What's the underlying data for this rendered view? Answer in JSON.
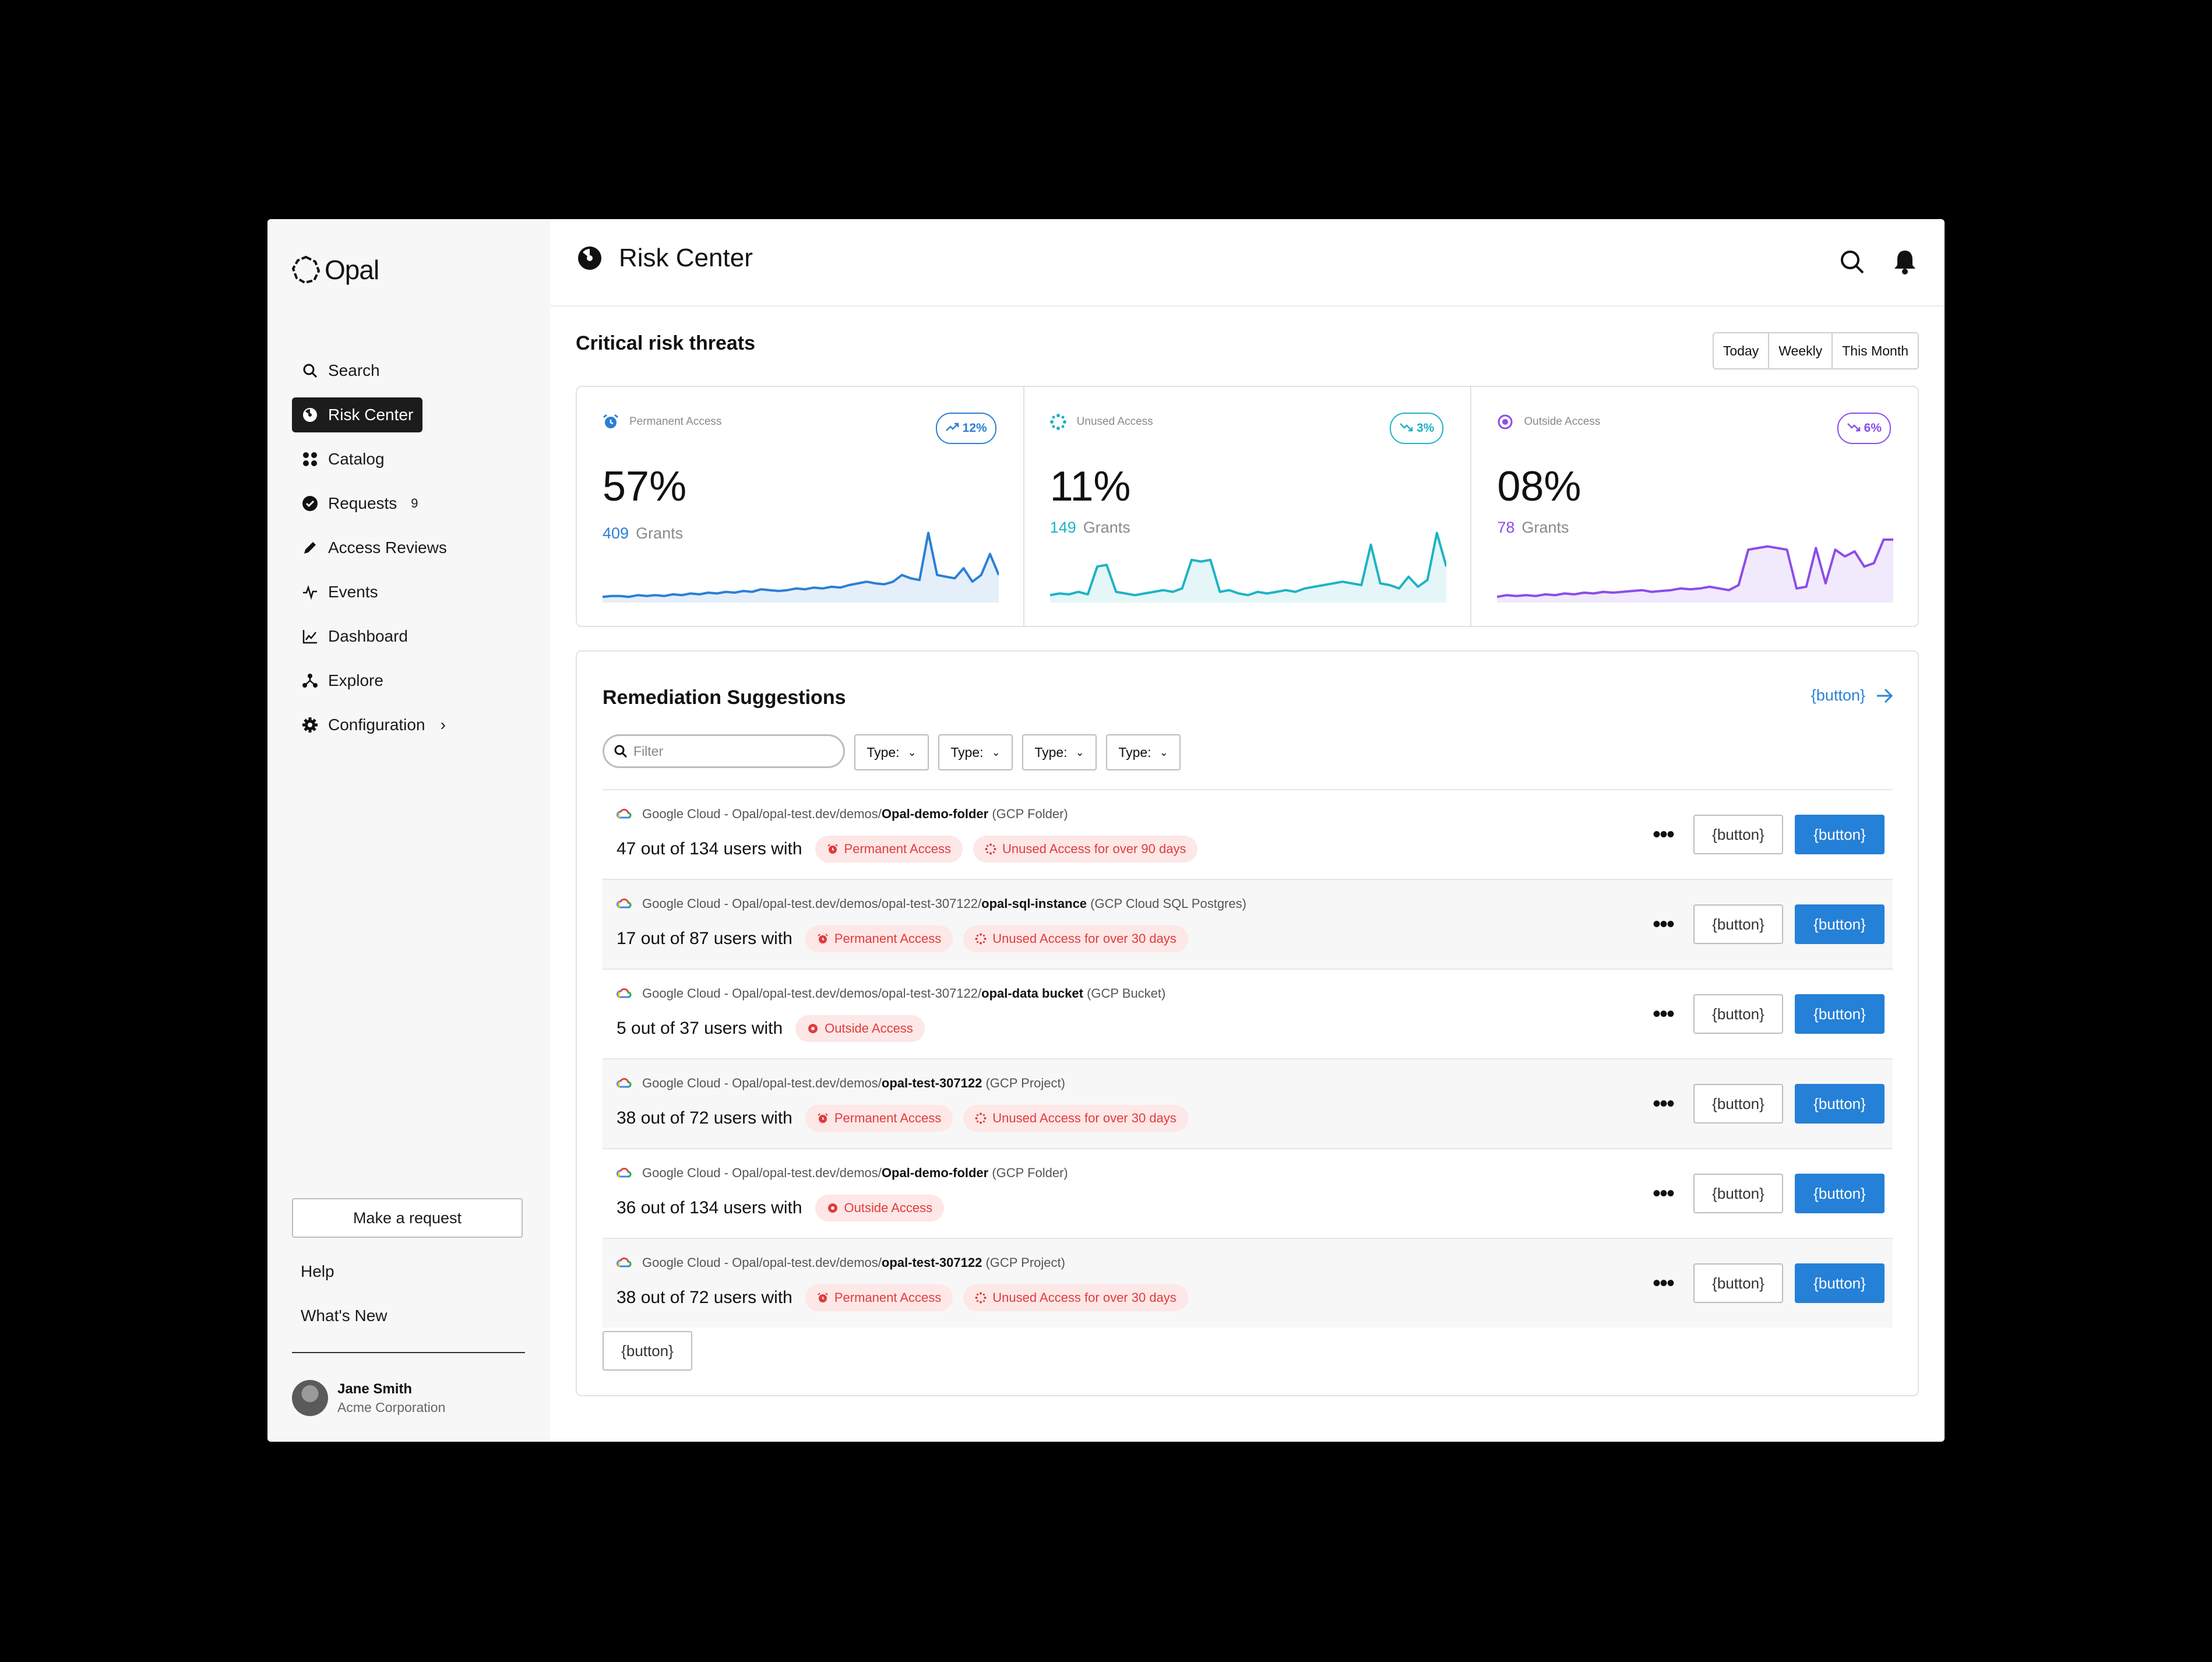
{
  "app": {
    "name": "Opal"
  },
  "sidebar": {
    "items": [
      {
        "label": "Search",
        "icon": "search-icon"
      },
      {
        "label": "Risk Center",
        "icon": "risk-icon",
        "active": true
      },
      {
        "label": "Catalog",
        "icon": "grid-icon"
      },
      {
        "label": "Requests",
        "icon": "check-circle-icon",
        "count": "9"
      },
      {
        "label": "Access Reviews",
        "icon": "pencil-icon"
      },
      {
        "label": "Events",
        "icon": "activity-icon"
      },
      {
        "label": "Dashboard",
        "icon": "chart-icon"
      },
      {
        "label": "Explore",
        "icon": "nodes-icon"
      },
      {
        "label": "Configuration",
        "icon": "gear-icon",
        "has_submenu": true
      }
    ],
    "make_request": "Make a request",
    "help": "Help",
    "whats_new": "What's New",
    "user": {
      "name": "Jane Smith",
      "org": "Acme Corporation"
    }
  },
  "header": {
    "title": "Risk Center"
  },
  "risk": {
    "title": "Critical risk threats",
    "periods": [
      "Today",
      "Weekly",
      "This Month"
    ],
    "metrics": [
      {
        "label": "Permanent Access",
        "trend": "12%",
        "trend_dir": "up",
        "value": "57%",
        "grants_count": "409",
        "grants_label": "Grants",
        "color": "#2b7fd4",
        "series": [
          4,
          5,
          5,
          4,
          6,
          5,
          6,
          5,
          7,
          6,
          8,
          7,
          9,
          8,
          10,
          9,
          11,
          10,
          13,
          12,
          11,
          12,
          14,
          13,
          15,
          14,
          16,
          15,
          18,
          20,
          22,
          20,
          19,
          22,
          30,
          26,
          24,
          80,
          30,
          28,
          26,
          38,
          22,
          30,
          55,
          30
        ]
      },
      {
        "label": "Unused Access",
        "trend": "3%",
        "trend_dir": "down",
        "value": "11%",
        "grants_count": "149",
        "grants_label": "Grants",
        "color": "#1eb3c4",
        "series": [
          6,
          8,
          7,
          10,
          7,
          40,
          42,
          10,
          8,
          6,
          8,
          10,
          12,
          10,
          14,
          48,
          46,
          48,
          10,
          12,
          8,
          6,
          10,
          8,
          10,
          12,
          10,
          14,
          16,
          18,
          20,
          22,
          20,
          18,
          66,
          20,
          18,
          14,
          28,
          16,
          24,
          80,
          40
        ]
      },
      {
        "label": "Outside Access",
        "trend": "6%",
        "trend_dir": "down",
        "value": "08%",
        "grants_count": "78",
        "grants_label": "Grants",
        "color": "#8b4dea",
        "series": [
          4,
          6,
          5,
          6,
          5,
          7,
          6,
          8,
          7,
          9,
          8,
          10,
          9,
          10,
          11,
          12,
          10,
          11,
          12,
          14,
          13,
          14,
          16,
          14,
          12,
          18,
          60,
          62,
          64,
          62,
          60,
          14,
          16,
          62,
          20,
          60,
          52,
          58,
          40,
          44,
          72,
          72
        ]
      }
    ]
  },
  "remediation": {
    "title": "Remediation Suggestions",
    "link": "{button}",
    "filter_placeholder": "Filter",
    "type_filters": [
      "Type:",
      "Type:",
      "Type:",
      "Type:"
    ],
    "rows": [
      {
        "path_prefix": "Google Cloud - Opal/opal-test.dev/demos/",
        "resource": "Opal-demo-folder",
        "kind": "(GCP Folder)",
        "count": "47 out of 134 users with",
        "tags": [
          {
            "label": "Permanent Access",
            "icon": "alarm-icon"
          },
          {
            "label": "Unused Access for over 90 days",
            "icon": "dotted-circle-icon"
          }
        ],
        "secondary": "{button}",
        "primary": "{button}"
      },
      {
        "path_prefix": "Google Cloud - Opal/opal-test.dev/demos/opal-test-307122/",
        "resource": "opal-sql-instance",
        "kind": "(GCP Cloud SQL Postgres)",
        "count": "17 out of 87 users with",
        "tags": [
          {
            "label": "Permanent Access",
            "icon": "alarm-icon"
          },
          {
            "label": "Unused Access for over 30 days",
            "icon": "dotted-circle-icon"
          }
        ],
        "secondary": "{button}",
        "primary": "{button}"
      },
      {
        "path_prefix": "Google Cloud - Opal/opal-test.dev/demos/opal-test-307122/",
        "resource": "opal-data bucket",
        "kind": "(GCP Bucket)",
        "count": "5 out of 37 users with",
        "tags": [
          {
            "label": "Outside Access",
            "icon": "target-icon"
          }
        ],
        "secondary": "{button}",
        "primary": "{button}"
      },
      {
        "path_prefix": "Google Cloud - Opal/opal-test.dev/demos/",
        "resource": "opal-test-307122",
        "kind": "(GCP Project)",
        "count": "38 out of 72 users with",
        "tags": [
          {
            "label": "Permanent Access",
            "icon": "alarm-icon"
          },
          {
            "label": "Unused Access for over 30 days",
            "icon": "dotted-circle-icon"
          }
        ],
        "secondary": "{button}",
        "primary": "{button}"
      },
      {
        "path_prefix": "Google Cloud - Opal/opal-test.dev/demos/",
        "resource": "Opal-demo-folder",
        "kind": "(GCP Folder)",
        "count": "36 out of 134 users with",
        "tags": [
          {
            "label": "Outside Access",
            "icon": "target-icon"
          }
        ],
        "secondary": "{button}",
        "primary": "{button}"
      },
      {
        "path_prefix": "Google Cloud - Opal/opal-test.dev/demos/",
        "resource": "opal-test-307122",
        "kind": "(GCP Project)",
        "count": "38 out of 72 users with",
        "tags": [
          {
            "label": "Permanent Access",
            "icon": "alarm-icon"
          },
          {
            "label": "Unused Access for over 30 days",
            "icon": "dotted-circle-icon"
          }
        ],
        "secondary": "{button}",
        "primary": "{button}"
      }
    ],
    "more_button": "{button}"
  }
}
